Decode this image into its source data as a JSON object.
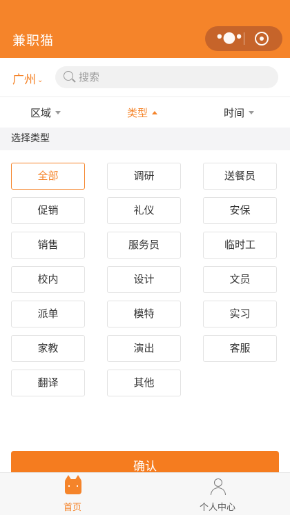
{
  "header": {
    "title": "兼职猫"
  },
  "location": {
    "city": "广州"
  },
  "search": {
    "placeholder": "搜索"
  },
  "filters": [
    {
      "label": "区域",
      "active": false
    },
    {
      "label": "类型",
      "active": true
    },
    {
      "label": "时间",
      "active": false
    }
  ],
  "section": {
    "title": "选择类型"
  },
  "categories": [
    "全部",
    "调研",
    "送餐员",
    "促销",
    "礼仪",
    "安保",
    "销售",
    "服务员",
    "临时工",
    "校内",
    "设计",
    "文员",
    "派单",
    "模特",
    "实习",
    "家教",
    "演出",
    "客服",
    "翻译",
    "其他"
  ],
  "selected_category": "全部",
  "confirm_label": "确认",
  "tabbar": [
    {
      "label": "首页",
      "active": true
    },
    {
      "label": "个人中心",
      "active": false
    }
  ],
  "colors": {
    "accent": "#f5842a",
    "header": "#f5842a"
  }
}
